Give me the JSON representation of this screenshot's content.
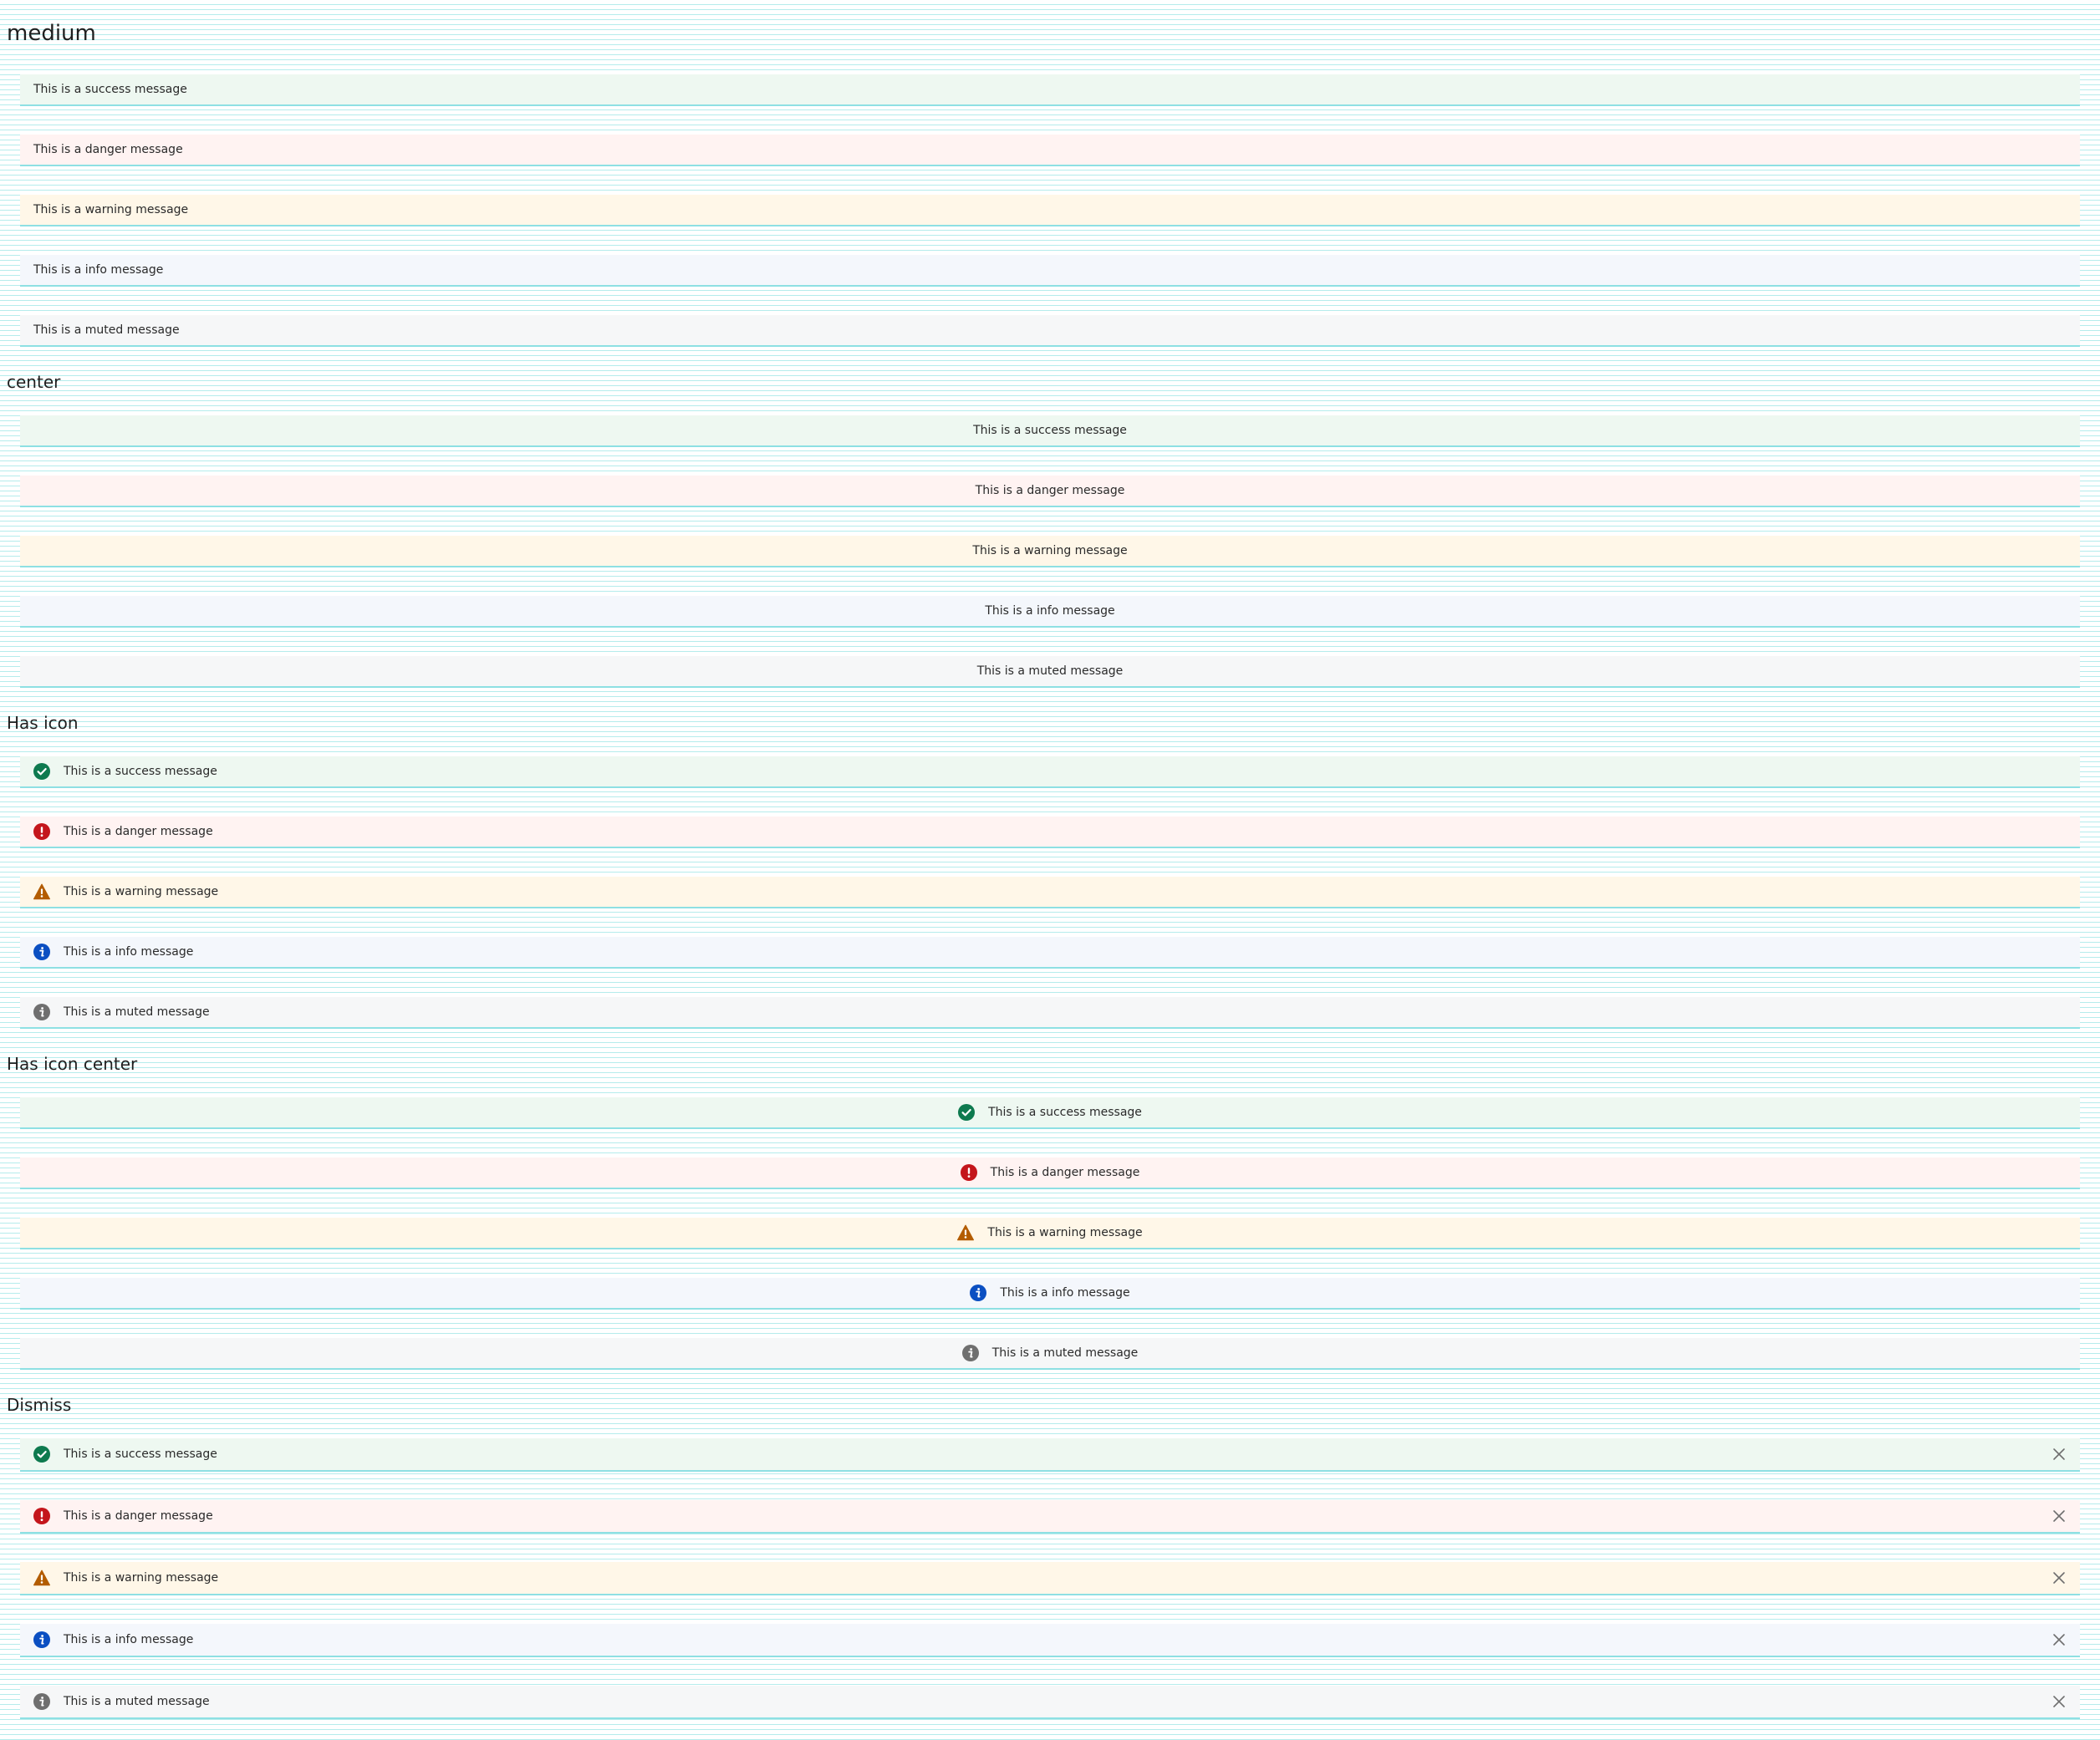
{
  "colors": {
    "success": "#0e7a4f",
    "danger": "#c4161c",
    "warning": "#b35c00",
    "info": "#0b4fc2",
    "muted": "#6f6f6f"
  },
  "sections": {
    "medium": {
      "title": "medium",
      "items": [
        {
          "type": "success",
          "text": "This is a success message"
        },
        {
          "type": "danger",
          "text": "This is a danger message"
        },
        {
          "type": "warning",
          "text": "This is a warning message"
        },
        {
          "type": "info",
          "text": "This is a info message"
        },
        {
          "type": "muted",
          "text": "This is a muted message"
        }
      ]
    },
    "center": {
      "title": "center",
      "items": [
        {
          "type": "success",
          "text": "This is a success message"
        },
        {
          "type": "danger",
          "text": "This is a danger message"
        },
        {
          "type": "warning",
          "text": "This is a warning message"
        },
        {
          "type": "info",
          "text": "This is a info message"
        },
        {
          "type": "muted",
          "text": "This is a muted message"
        }
      ]
    },
    "has_icon": {
      "title": "Has icon",
      "items": [
        {
          "type": "success",
          "icon": "check-circle-icon",
          "text": "This is a success message"
        },
        {
          "type": "danger",
          "icon": "exclamation-circle-icon",
          "text": "This is a danger message"
        },
        {
          "type": "warning",
          "icon": "warning-triangle-icon",
          "text": "This is a warning message"
        },
        {
          "type": "info",
          "icon": "info-circle-icon",
          "text": "This is a info message"
        },
        {
          "type": "muted",
          "icon": "info-circle-icon",
          "text": "This is a muted message"
        }
      ]
    },
    "has_icon_center": {
      "title": "Has icon center",
      "items": [
        {
          "type": "success",
          "icon": "check-circle-icon",
          "text": "This is a success message"
        },
        {
          "type": "danger",
          "icon": "exclamation-circle-icon",
          "text": "This is a danger message"
        },
        {
          "type": "warning",
          "icon": "warning-triangle-icon",
          "text": "This is a warning message"
        },
        {
          "type": "info",
          "icon": "info-circle-icon",
          "text": "This is a info message"
        },
        {
          "type": "muted",
          "icon": "info-circle-icon",
          "text": "This is a muted message"
        }
      ]
    },
    "dismiss": {
      "title": "Dismiss",
      "close_icon": "close-icon",
      "items": [
        {
          "type": "success",
          "icon": "check-circle-icon",
          "text": "This is a success message"
        },
        {
          "type": "danger",
          "icon": "exclamation-circle-icon",
          "text": "This is a danger message"
        },
        {
          "type": "warning",
          "icon": "warning-triangle-icon",
          "text": "This is a warning message"
        },
        {
          "type": "info",
          "icon": "info-circle-icon",
          "text": "This is a info message"
        },
        {
          "type": "muted",
          "icon": "info-circle-icon",
          "text": "This is a muted message"
        }
      ]
    }
  }
}
